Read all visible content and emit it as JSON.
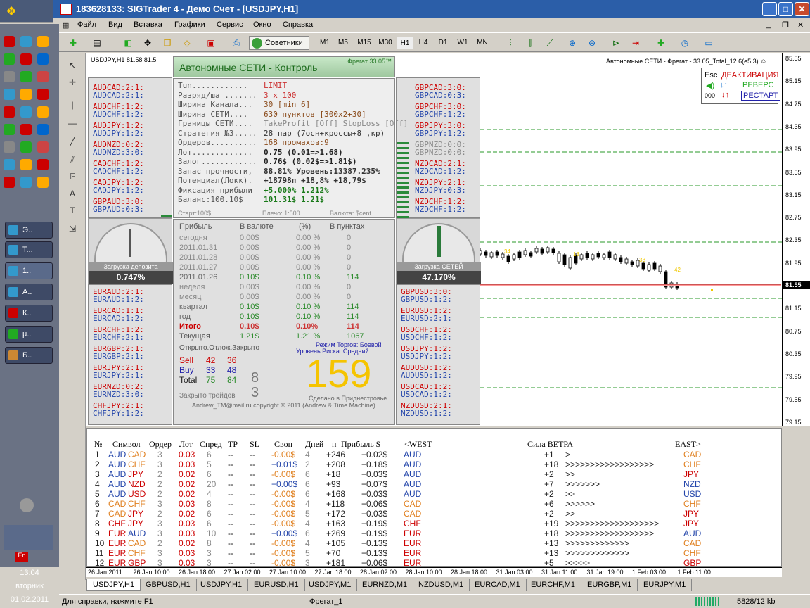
{
  "window": {
    "title": "183628133: SIGTrader 4 - Демо Счет - [USDJPY,H1]"
  },
  "menu": [
    "Файл",
    "Вид",
    "Вставка",
    "Графики",
    "Сервис",
    "Окно",
    "Справка"
  ],
  "toolbar": {
    "advisors_label": "Советники",
    "timeframes": [
      "M1",
      "M5",
      "M15",
      "M30",
      "H1",
      "H4",
      "D1",
      "W1",
      "MN"
    ],
    "selected_tf": "H1"
  },
  "taskbar": {
    "items": [
      "Э..",
      "Т...",
      "1..",
      "А..",
      "К..",
      "μ..",
      "Б.."
    ],
    "clock_time": "13:04",
    "clock_day": "вторник",
    "clock_date": "01.02.2011",
    "lang": "En"
  },
  "chart": {
    "symbol_header": "USDJPY,H1  81.58 81.5",
    "right_header": "Автономные СЕТИ - Фрегат - 33.05_Total_12.6(e5.3) ☺",
    "price_labels": [
      "85.55",
      "85.15",
      "84.75",
      "84.35",
      "83.95",
      "83.55",
      "83.15",
      "82.75",
      "82.35",
      "81.95",
      "81.55",
      "81.15",
      "80.75",
      "80.35",
      "79.95",
      "79.55",
      "79.15"
    ],
    "current_price": "81.55",
    "candle_labels": [
      "34",
      "18",
      "33",
      "42"
    ],
    "time_labels": [
      "26 Jan 2011",
      "26 Jan 10:00",
      "26 Jan 18:00",
      "27 Jan 02:00",
      "27 Jan 10:00",
      "27 Jan 18:00",
      "28 Jan 02:00",
      "28 Jan 10:00",
      "28 Jan 18:00",
      "31 Jan 03:00",
      "31 Jan 11:00",
      "31 Jan 19:00",
      "1 Feb 03:00",
      "1 Feb 11:00"
    ]
  },
  "control": {
    "esc": "Esc",
    "deactivate": "ДЕАКТИВАЦИЯ",
    "reverse": "РЕВЕРС",
    "counter": "000",
    "restart": "РЕСТАРТ"
  },
  "panel": {
    "title": "Автономные СЕТИ - Контроль",
    "version": "Фрегат 33.05™",
    "rows": [
      {
        "k": "Tun............",
        "v": "LIMIT"
      },
      {
        "k": "Разряд/шаг.......",
        "v": "3 x 100"
      },
      {
        "k": "Ширина Канала...",
        "v": "30  [min 6]"
      },
      {
        "k": "Ширина СЕТИ....",
        "v": "630 пунктов [300x2+30]"
      },
      {
        "k": "Границы СЕТИ....",
        "v": "TakeProfit [Off]    StopLoss [Off]"
      },
      {
        "k": "Стратегия №3.....",
        "v": "28 пар (7осн+кроссы+8т,кр)"
      },
      {
        "k": "Ордеров..........",
        "v": "168   промахов:9"
      },
      {
        "k": "Лот.............",
        "v": "0.75 (0.01=>1.68)"
      },
      {
        "k": "Залог............",
        "v": "0.76$ (0.02$=>1.81$)"
      },
      {
        "k": "Запас прочности,",
        "v": "88.81%  Уровень:13387.235%"
      },
      {
        "k": "Потенциал(Локк).",
        "v": "+18798п +18,8% +18,79$"
      },
      {
        "k": "Фиксация прибыли",
        "v": "+5.000%          1.212%"
      },
      {
        "k": "Баланс:100.10$",
        "v": "101.31$          1.21$"
      }
    ],
    "footer": {
      "start": "Старт:100$",
      "leverage": "Плечо: 1:500",
      "currency": "Валюта: $cent"
    },
    "stats_header": [
      "Прибыль",
      "В валюте",
      "(%)",
      "В пунктах"
    ],
    "stats": [
      [
        "сегодня",
        "0.00$",
        "0.00 %",
        "0"
      ],
      [
        "2011.01.31",
        "0.00$",
        "0.00 %",
        "0"
      ],
      [
        "2011.01.28",
        "0.00$",
        "0.00 %",
        "0"
      ],
      [
        "2011.01.27",
        "0.00$",
        "0.00 %",
        "0"
      ],
      [
        "2011.01.26",
        "0.10$",
        "0.10 %",
        "114"
      ],
      [
        "неделя",
        "0.00$",
        "0.00 %",
        "0"
      ],
      [
        "месяц",
        "0.00$",
        "0.00 %",
        "0"
      ],
      [
        "квартал",
        "0.10$",
        "0.10 %",
        "114"
      ],
      [
        "год",
        "0.10$",
        "0.10 %",
        "114"
      ],
      [
        "Итого",
        "0.10$",
        "0.10%",
        "114"
      ],
      [
        "Текущая",
        "1.21$",
        "1.21 %",
        "1067"
      ]
    ],
    "open_header": "Открыто.Отлож.Закрыто",
    "mode": "Режим Торгов:  Боевой",
    "risk": "Уровень Риска:  Средний",
    "sell": [
      "Sell",
      "42",
      "36"
    ],
    "buy": [
      "Buy",
      "33",
      "48"
    ],
    "total": [
      "Total",
      "75",
      "84"
    ],
    "closed_n": "8",
    "closed_label": "Закрыто трейдов",
    "closed_n2": "3",
    "big": "159",
    "made": "Сделано в Приднестровье",
    "copyright": "Andrew_TM@mail.ru    copyright © 2011   (Andrew & Time Machine)"
  },
  "gauges": {
    "deposit_label": "Загрузка депозита",
    "deposit_value": "0.747%",
    "nets_label": "Загрузка СЕТЕЙ",
    "nets_value": "47.170%"
  },
  "left_top": [
    "AUDCAD:2:1:",
    "AUDCAD:2:1:",
    "",
    "AUDCHF:1:2:",
    "AUDCHF:1:2:",
    "",
    "AUDJPY:1:2:",
    "AUDJPY:1:2:",
    "",
    "AUDNZD:0:2:",
    "AUDNZD:3:0:",
    "",
    "CADCHF:1:2:",
    "CADCHF:1:2:",
    "",
    "CADJPY:1:2:",
    "CADJPY:1:2:",
    "",
    "GBPAUD:3:0:",
    "GBPAUD:0:3:"
  ],
  "right_top": [
    "GBPCAD:3:0:",
    "GBPCAD:0:3:",
    "",
    "GBPCHF:3:0:",
    "GBPCHF:1:2:",
    "",
    "GBPJPY:3:0:",
    "GBPJPY:1:2:",
    "",
    "GBPNZD:0:0:",
    "GBPNZD:0:0:",
    "",
    "NZDCAD:2:1:",
    "NZDCAD:1:2:",
    "",
    "NZDJPY:2:1:",
    "NZDJPY:0:3:",
    "",
    "NZDCHF:1:2:",
    "NZDCHF:1:2:"
  ],
  "left_bot": [
    "EURAUD:2:1:",
    "EURAUD:1:2:",
    "",
    "EURCAD:1:1:",
    "EURCAD:1:2:",
    "",
    "EURCHF:1:2:",
    "EURCHF:2:1:",
    "",
    "EURGBP:2:1:",
    "EURGBP:2:1:",
    "",
    "EURJPY:2:1:",
    "EURJPY:2:1:",
    "",
    "EURNZD:0:2:",
    "EURNZD:3:0:",
    "",
    "CHFJPY:2:1:",
    "CHFJPY:1:2:"
  ],
  "right_bot": [
    "GBPUSD:3:0:",
    "GBPUSD:1:2:",
    "",
    "EURUSD:1:2:",
    "EURUSD:2:1:",
    "",
    "USDCHF:1:2:",
    "USDCHF:1:2:",
    "",
    "USDJPY:1:2:",
    "USDJPY:1:2:",
    "",
    "AUDUSD:1:2:",
    "AUDUSD:1:2:",
    "",
    "USDCAD:1:2:",
    "USDCAD:1:2:",
    "",
    "NZDUSD:2:1:",
    "NZDUSD:1:2:"
  ],
  "terminal": {
    "headers": [
      "№",
      "Символ",
      "Ордер",
      "Лот",
      "Спред",
      "TP",
      "SL",
      "Своп",
      "Дней",
      "п",
      "Прибыль $",
      "<WEST",
      "Сила ВЕТРА",
      "EAST>"
    ],
    "rows": [
      [
        "1",
        "AUD",
        "CAD",
        "3",
        "0.03",
        "6",
        "--",
        "--",
        "-0.00$",
        "4",
        "+246",
        "+0.02$",
        "AUD",
        "+1",
        ">",
        "CAD"
      ],
      [
        "2",
        "AUD",
        "CHF",
        "3",
        "0.03",
        "5",
        "--",
        "--",
        "+0.01$",
        "2",
        "+208",
        "+0.18$",
        "AUD",
        "+18",
        ">>>>>>>>>>>>>>>>>>",
        "CHF"
      ],
      [
        "3",
        "AUD",
        "JPY",
        "2",
        "0.02",
        "6",
        "--",
        "--",
        "-0.00$",
        "6",
        "+18",
        "+0.03$",
        "AUD",
        "+2",
        ">>",
        "JPY"
      ],
      [
        "4",
        "AUD",
        "NZD",
        "2",
        "0.02",
        "20",
        "--",
        "--",
        "+0.00$",
        "6",
        "+93",
        "+0.07$",
        "AUD",
        "+7",
        ">>>>>>>",
        "NZD"
      ],
      [
        "5",
        "AUD",
        "USD",
        "2",
        "0.02",
        "4",
        "--",
        "--",
        "-0.00$",
        "6",
        "+168",
        "+0.03$",
        "AUD",
        "+2",
        ">>",
        "USD"
      ],
      [
        "6",
        "CAD",
        "CHF",
        "3",
        "0.03",
        "8",
        "--",
        "--",
        "-0.00$",
        "4",
        "+118",
        "+0.06$",
        "CAD",
        "+6",
        ">>>>>>",
        "CHF"
      ],
      [
        "7",
        "CAD",
        "JPY",
        "2",
        "0.02",
        "6",
        "--",
        "--",
        "-0.00$",
        "5",
        "+172",
        "+0.03$",
        "CAD",
        "+2",
        ">>",
        "JPY"
      ],
      [
        "8",
        "CHF",
        "JPY",
        "3",
        "0.03",
        "6",
        "--",
        "--",
        "-0.00$",
        "4",
        "+163",
        "+0.19$",
        "CHF",
        "+19",
        ">>>>>>>>>>>>>>>>>>>",
        "JPY"
      ],
      [
        "9",
        "EUR",
        "AUD",
        "3",
        "0.03",
        "10",
        "--",
        "--",
        "+0.00$",
        "6",
        "+269",
        "+0.19$",
        "EUR",
        "+18",
        ">>>>>>>>>>>>>>>>>>",
        "AUD"
      ],
      [
        "10",
        "EUR",
        "CAD",
        "2",
        "0.02",
        "8",
        "--",
        "--",
        "-0.00$",
        "4",
        "+105",
        "+0.13$",
        "EUR",
        "+13",
        ">>>>>>>>>>>>>",
        "CAD"
      ],
      [
        "11",
        "EUR",
        "CHF",
        "3",
        "0.03",
        "3",
        "--",
        "--",
        "-0.00$",
        "5",
        "+70",
        "+0.13$",
        "EUR",
        "+13",
        ">>>>>>>>>>>>>",
        "CHF"
      ],
      [
        "12",
        "EUR",
        "GBP",
        "3",
        "0.03",
        "3",
        "--",
        "--",
        "-0.00$",
        "3",
        "+181",
        "+0.06$",
        "EUR",
        "+5",
        ">>>>>",
        "GBP"
      ]
    ]
  },
  "tabs": [
    "USDJPY,H1",
    "GBPUSD,H1",
    "USDJPY,H1",
    "EURUSD,H1",
    "USDJPY,M1",
    "EURNZD,M1",
    "NZDUSD,M1",
    "EURCAD,M1",
    "EURCHF,M1",
    "EURGBP,M1",
    "EURJPY,M1"
  ],
  "status": {
    "help": "Для справки, нажмите F1",
    "profile": "Фрегат_1",
    "traffic": "5828/12 kb"
  },
  "colors": {
    "accent": "#2b5ea8",
    "red": "#cc0000",
    "blue": "#2244aa",
    "green": "#2a9a2a",
    "big": "#f5c400"
  }
}
